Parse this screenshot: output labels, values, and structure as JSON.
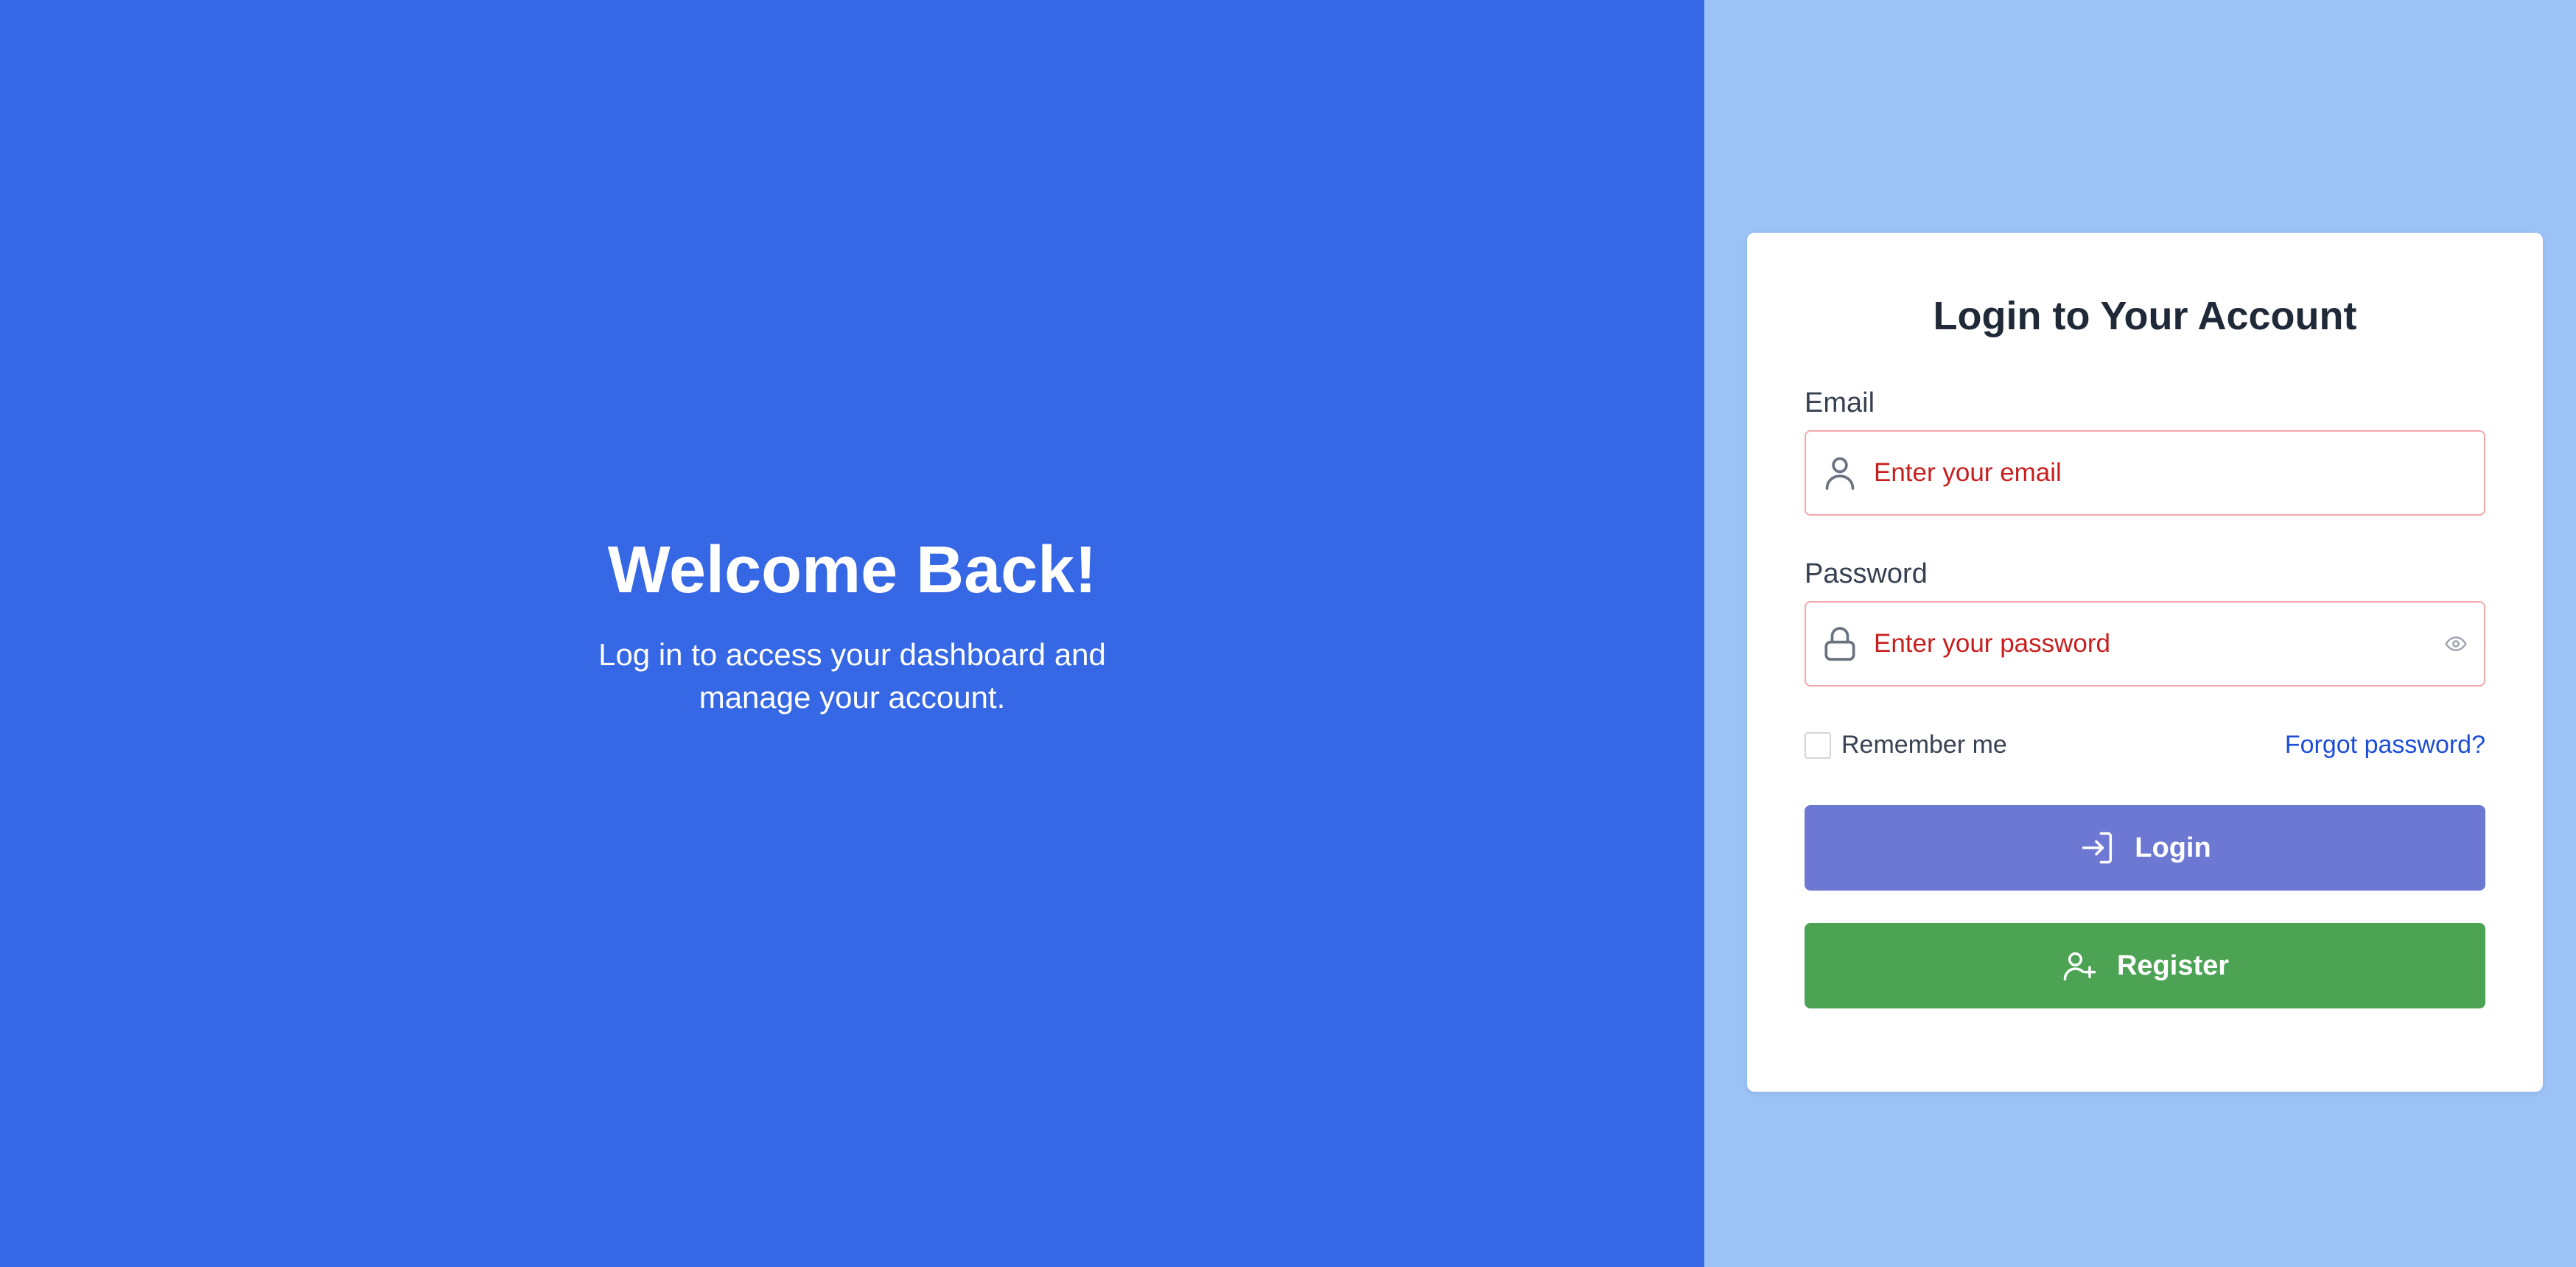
{
  "hero": {
    "title": "Welcome Back!",
    "subtitle": "Log in to access your dashboard and manage your account.",
    "background": "#3667e4"
  },
  "panel": {
    "background": "#9dc3f6"
  },
  "login_card": {
    "title": "Login to Your Account",
    "email": {
      "label": "Email",
      "placeholder": "Enter your email",
      "value": "",
      "icon": "user-icon"
    },
    "password": {
      "label": "Password",
      "placeholder": "Enter your password",
      "value": "",
      "icon": "lock-icon",
      "toggle_icon": "eye-icon"
    },
    "remember_me": {
      "label": "Remember me",
      "checked": false
    },
    "forgot_password": "Forgot password?",
    "login_button": {
      "label": "Login",
      "icon": "login-icon",
      "color": "#6c78d2"
    },
    "register_button": {
      "label": "Register",
      "icon": "user-plus-icon",
      "color": "#4ca354"
    },
    "error_color": "#c81e1e",
    "link_color": "#1d4ed8"
  }
}
